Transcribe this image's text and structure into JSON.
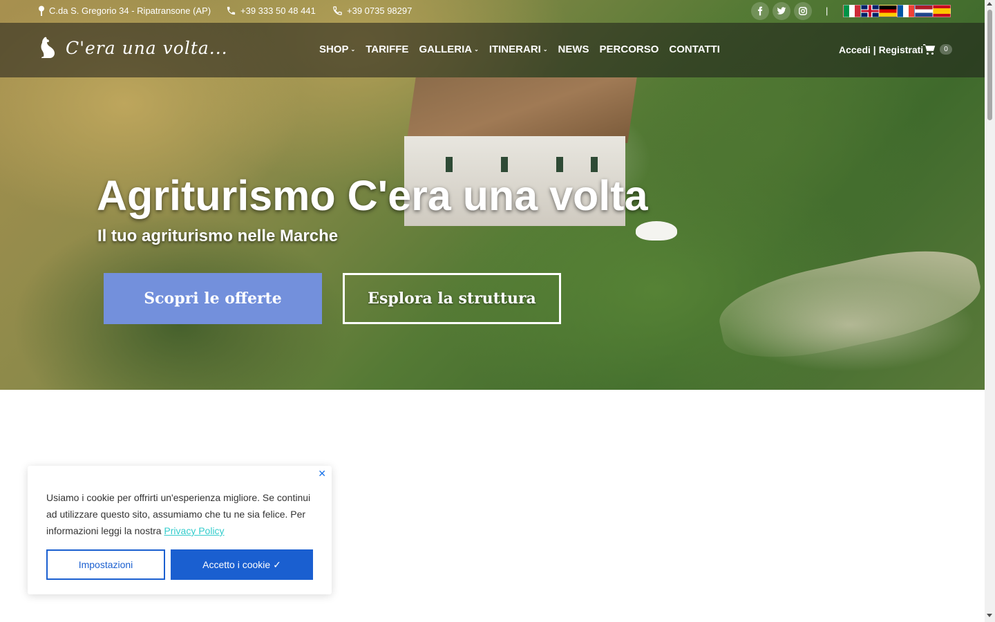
{
  "topbar": {
    "address": "C.da S. Gregorio 34 - Ripatransone (AP)",
    "mobile": "+39 333 50 48 441",
    "phone": "+39 0735 98297",
    "separator": "|",
    "social": [
      "facebook-icon",
      "twitter-icon",
      "instagram-icon"
    ],
    "languages": [
      "it",
      "en",
      "de",
      "fr",
      "nl",
      "es"
    ]
  },
  "header": {
    "logo_text": "C'era una volta...",
    "nav": [
      {
        "label": "SHOP",
        "has_dropdown": true
      },
      {
        "label": "TARIFFE",
        "has_dropdown": false
      },
      {
        "label": "GALLERIA",
        "has_dropdown": true
      },
      {
        "label": "ITINERARI",
        "has_dropdown": true
      },
      {
        "label": "NEWS",
        "has_dropdown": false
      },
      {
        "label": "PERCORSO",
        "has_dropdown": false
      },
      {
        "label": "CONTATTI",
        "has_dropdown": false
      }
    ],
    "caret": "⌄",
    "account": "Accedi | Registrati",
    "cart_count": "0"
  },
  "hero": {
    "title": "Agriturismo C'era una volta",
    "subtitle": "Il tuo agriturismo nelle Marche",
    "primary_button": "Scopri le offerte",
    "secondary_button": "Esplora la struttura"
  },
  "cookie": {
    "close": "✕",
    "text": "Usiamo i cookie per offrirti un'esperienza migliore. Se continui ad utilizzare questo sito, assumiamo che tu ne sia felice. Per informazioni leggi la nostra ",
    "link": "Privacy Policy",
    "settings_button": "Impostazioni",
    "accept_button": "Accetto i cookie ✓"
  },
  "colors": {
    "primary_button": "#7390dc",
    "cookie_accent": "#1a5fd0",
    "link": "#33cccc"
  }
}
